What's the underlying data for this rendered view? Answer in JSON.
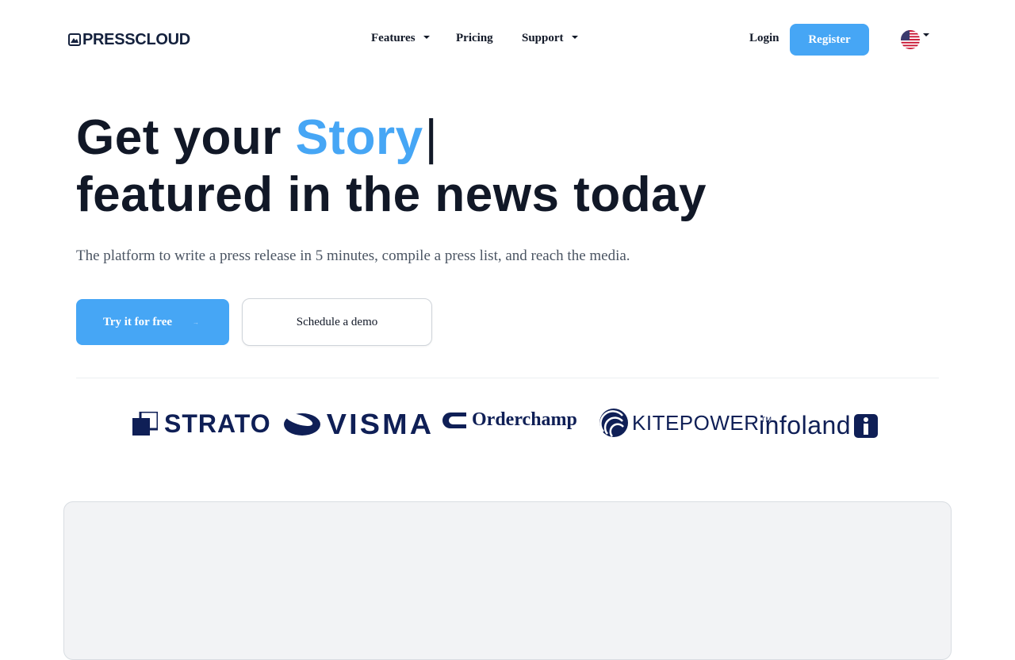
{
  "header": {
    "logo_text": "PRESSCLOUD",
    "nav": {
      "features": "Features",
      "pricing": "Pricing",
      "support": "Support"
    },
    "login_label": "Login",
    "register_label": "Register",
    "language_flag": "us-flag-icon"
  },
  "hero": {
    "title_prefix": "Get your ",
    "title_highlight": "Story",
    "title_cursor": "|",
    "title_line2": "featured in the news today",
    "subtitle": "The platform to write a press release in 5 minutes, compile a press list, and reach the media.",
    "primary_cta": "Try it for free",
    "secondary_cta": "Schedule a demo"
  },
  "logos": {
    "strato": "STRATO",
    "visma": "VISMA",
    "orderchamp": "Orderchamp",
    "kitepower": "KITEPOWER",
    "kitepower_tm": "TM",
    "infoland": "infoland"
  },
  "colors": {
    "accent": "#46a6f5",
    "heading": "#111827",
    "brand_navy": "#0f1f56",
    "preview_bg": "#f2f3f5"
  }
}
